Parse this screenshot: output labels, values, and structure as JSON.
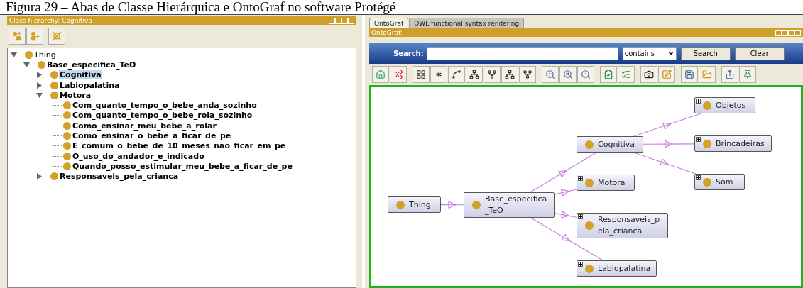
{
  "caption": "Figura 29 – Abas de Classe Hierárquica e OntoGraf no software Protégé",
  "class_hierarchy": {
    "title": "Class hierarchy: Cognitiva",
    "tree": [
      {
        "label": "Thing",
        "bold": false,
        "selected": false,
        "expanded": true,
        "children": [
          {
            "label": "Base_especifica_TeO",
            "bold": true,
            "selected": false,
            "expanded": true,
            "children": [
              {
                "label": "Cognitiva",
                "bold": true,
                "selected": true,
                "expanded": false
              },
              {
                "label": "Labiopalatina",
                "bold": true,
                "selected": false,
                "expanded": false
              },
              {
                "label": "Motora",
                "bold": true,
                "selected": false,
                "expanded": true,
                "children": [
                  {
                    "label": "Com_quanto_tempo_o_bebe_anda_sozinho",
                    "bold": true,
                    "selected": false
                  },
                  {
                    "label": "Com_quanto_tempo_o_bebe_rola_sozinho",
                    "bold": true,
                    "selected": false
                  },
                  {
                    "label": "Como_ensinar_meu_bebe_a_rolar",
                    "bold": true,
                    "selected": false
                  },
                  {
                    "label": "Como_ensinar_o_bebe_a_ficar_de_pe",
                    "bold": true,
                    "selected": false
                  },
                  {
                    "label": "E_comum_o_bebe_de_10_meses_nao_ficar_em_pe",
                    "bold": true,
                    "selected": false
                  },
                  {
                    "label": "O_uso_do_andador_e_indicado",
                    "bold": true,
                    "selected": false
                  },
                  {
                    "label": "Quando_posso_estimular_meu_bebe_a_ficar_de_pe",
                    "bold": true,
                    "selected": false
                  }
                ]
              },
              {
                "label": "Responsaveis_pela_crianca",
                "bold": true,
                "selected": false,
                "expanded": false
              }
            ]
          }
        ]
      }
    ]
  },
  "tabs": [
    {
      "label": "OntoGraf",
      "selected": true
    },
    {
      "label": "OWL functional syntax rendering",
      "selected": false
    }
  ],
  "ontograf": {
    "title": "OntoGraf:",
    "search": {
      "label": "Search:",
      "mode": "contains",
      "buttons": [
        "Search",
        "Clear"
      ]
    },
    "nodes": [
      {
        "label": "Thing",
        "expandable": false
      },
      {
        "label": "Base_especifica_TeO",
        "expandable": false
      },
      {
        "label": "Cognitiva",
        "expandable": false
      },
      {
        "label": "Motora",
        "expandable": true
      },
      {
        "label": "Responsaveis_pela_crianca",
        "expandable": true
      },
      {
        "label": "Labiopalatina",
        "expandable": true
      },
      {
        "label": "Objetos",
        "expandable": true
      },
      {
        "label": "Brincadeiras",
        "expandable": true
      },
      {
        "label": "Som",
        "expandable": true
      }
    ]
  }
}
